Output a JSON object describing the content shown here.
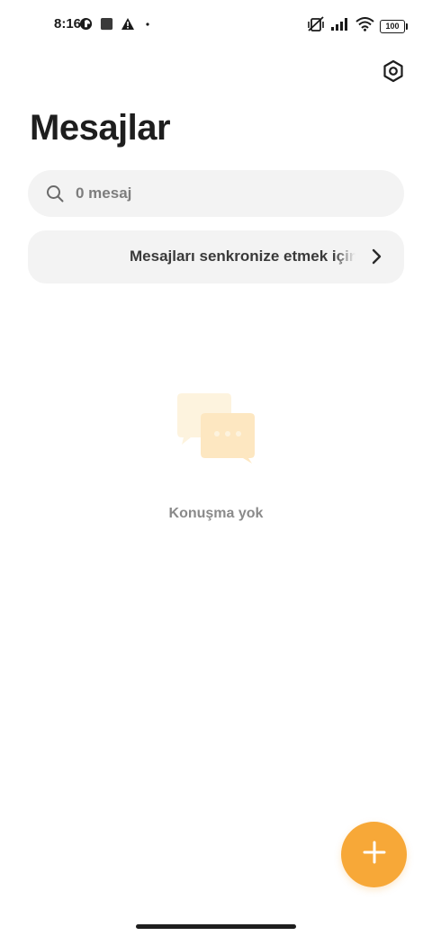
{
  "status_bar": {
    "time": "8:16",
    "battery": "100",
    "icons": [
      "data-saver-icon",
      "square-notification-icon",
      "warning-icon",
      "dot-icon",
      "vibrate-off-icon",
      "signal-icon",
      "wifi-icon",
      "battery-icon"
    ]
  },
  "header": {
    "title": "Mesajlar",
    "settings_icon": "settings-icon"
  },
  "search": {
    "placeholder": "0 mesaj",
    "value": ""
  },
  "sync_banner": {
    "text": "Mesajları senkronize etmek için cl"
  },
  "empty_state": {
    "text": "Konuşma yok",
    "icon": "chat-bubbles-icon"
  },
  "fab": {
    "icon": "plus-icon"
  },
  "colors": {
    "accent": "#f7a838",
    "surface": "#f3f3f3",
    "empty_icon_light": "#fdf3de",
    "empty_icon_dark": "#fde7c1"
  }
}
